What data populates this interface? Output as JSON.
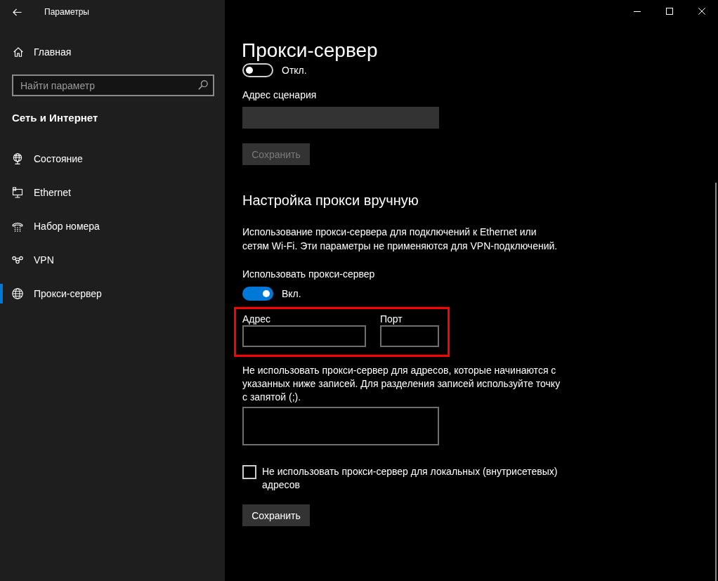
{
  "window": {
    "title": "Параметры"
  },
  "sidebar": {
    "home": {
      "label": "Главная"
    },
    "search": {
      "placeholder": "Найти параметр"
    },
    "section_title": "Сеть и Интернет",
    "items": [
      {
        "kind": "status",
        "label": "Состояние",
        "selected": false
      },
      {
        "kind": "ethernet",
        "label": "Ethernet",
        "selected": false
      },
      {
        "kind": "dialup",
        "label": "Набор номера",
        "selected": false
      },
      {
        "kind": "vpn",
        "label": "VPN",
        "selected": false
      },
      {
        "kind": "proxy",
        "label": "Прокси-сервер",
        "selected": true
      }
    ]
  },
  "page": {
    "title": "Прокси-сервер",
    "auto_setup": {
      "toggle": {
        "on": false,
        "state_label": "Откл."
      },
      "script_address": {
        "label": "Адрес сценария",
        "disabled": true
      },
      "save_button": {
        "label": "Сохранить",
        "disabled": true
      }
    },
    "manual_setup": {
      "heading": "Настройка прокси вручную",
      "description": "Использование прокси-сервера для подключений к Ethernet или сетям Wi-Fi. Эти параметры не применяются для VPN-подключений.",
      "use_proxy": {
        "label": "Использовать прокси-сервер",
        "on": true,
        "state_label": "Вкл."
      },
      "proxy_fields": {
        "highlighted": true,
        "address": {
          "label": "Адрес",
          "disabled": false
        },
        "port": {
          "label": "Порт",
          "disabled": false
        }
      },
      "exceptions": {
        "description": "Не использовать прокси-сервер для адресов, которые начинаются с указанных ниже записей. Для разделения записей используйте точку с запятой (;).",
        "disabled": false
      },
      "bypass_local": {
        "label": "Не использовать прокси-сервер для локальных (внутрисетевых) адресов",
        "checked": false
      },
      "save_button": {
        "label": "Сохранить",
        "disabled": false
      }
    }
  }
}
